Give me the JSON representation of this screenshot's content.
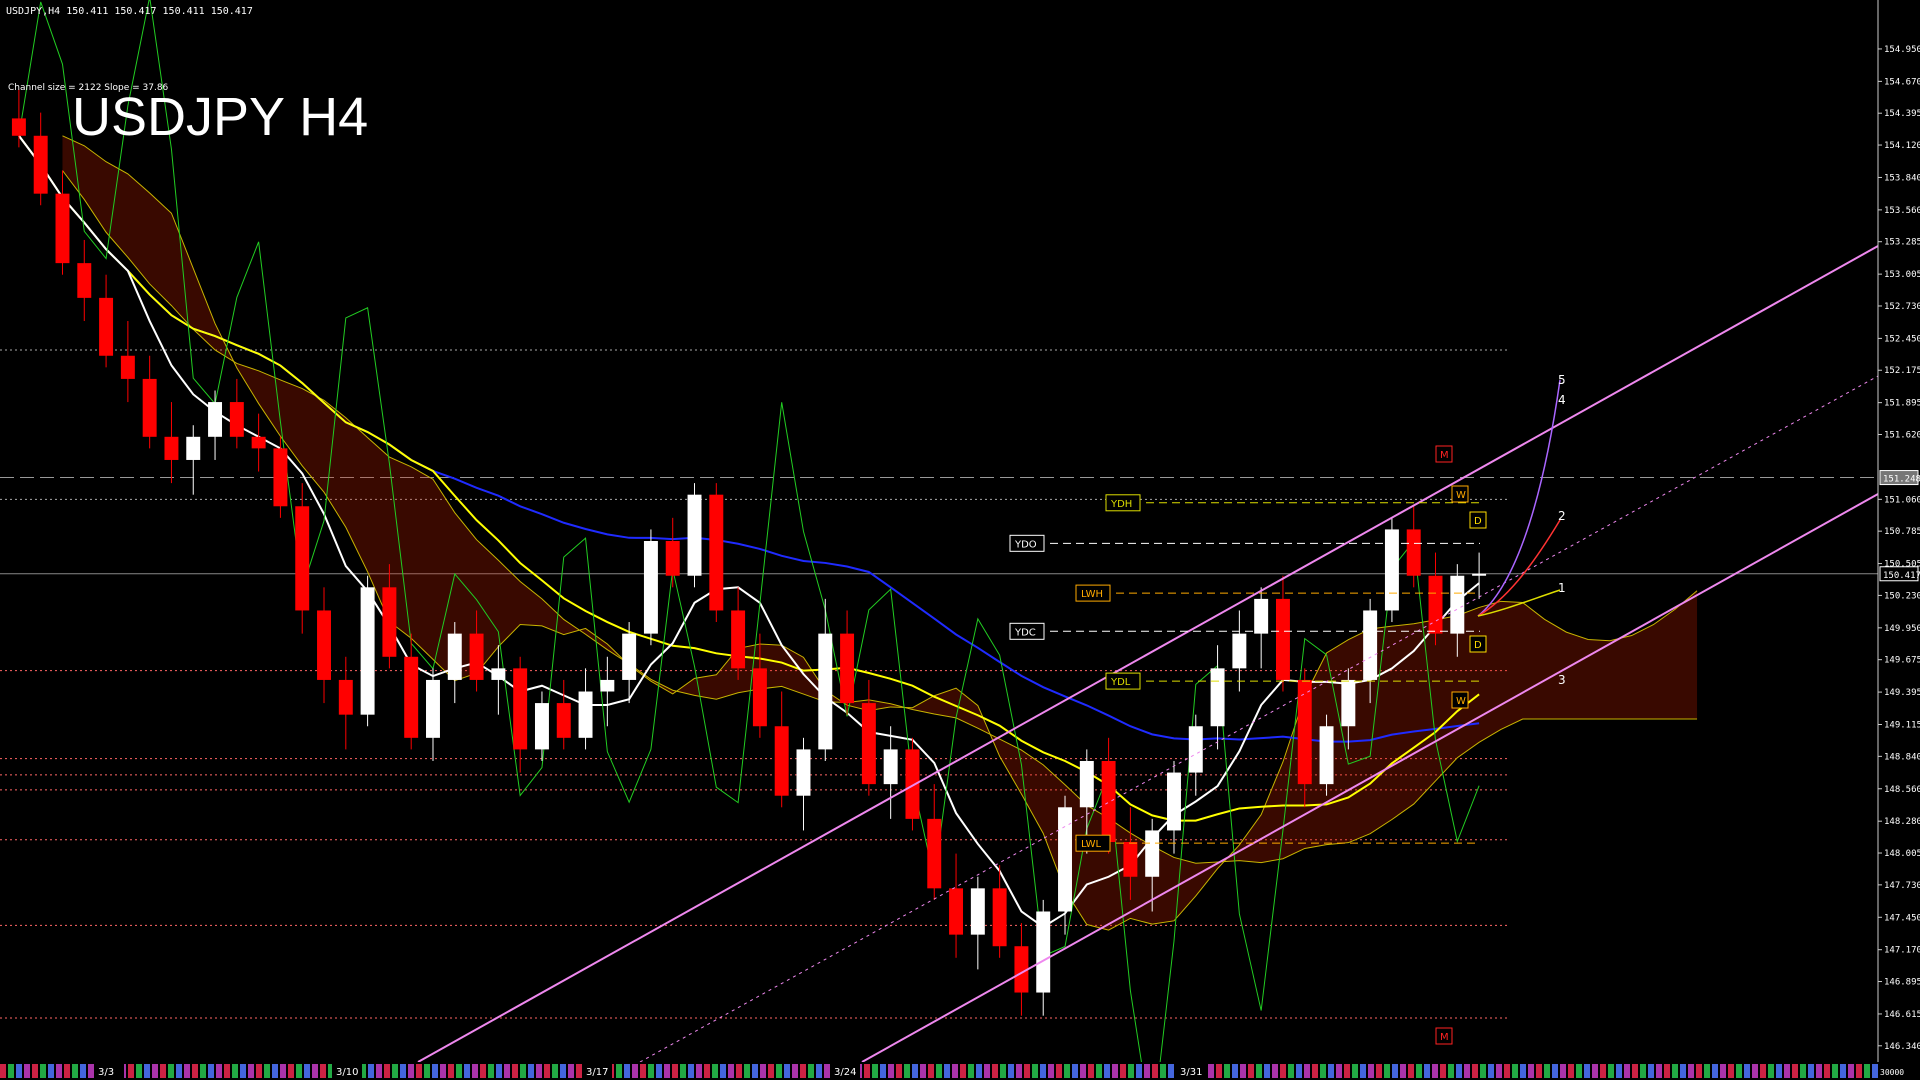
{
  "header": {
    "symbol_line": "USDJPY,H4  150.411 150.417 150.411 150.417"
  },
  "channel_info": "Channel size = 2122 Slope = 37.86",
  "big_title": "USDJPY H4",
  "colors": {
    "background": "#000000",
    "bull": "#ffffff",
    "bear": "#ff0000",
    "ma_blue": "#1f2bff",
    "ma_yellow": "#ffff00",
    "ma_white": "#ffffff",
    "green": "#22cc22",
    "channel": "#ee88ee",
    "cloud": "#cc2200",
    "cloud_line": "#c8b400"
  },
  "chart_data": {
    "type": "candlestick",
    "symbol": "USDJPY",
    "timeframe": "H4",
    "ylim": [
      146.2,
      155.2
    ],
    "y_ticks": [
      "154.950",
      "154.670",
      "154.395",
      "154.120",
      "153.840",
      "153.560",
      "153.285",
      "153.005",
      "152.730",
      "152.450",
      "152.175",
      "151.895",
      "151.620",
      "151.060",
      "150.785",
      "150.505",
      "150.230",
      "149.950",
      "149.675",
      "149.395",
      "149.115",
      "148.840",
      "148.560",
      "148.280",
      "148.005",
      "147.730",
      "147.450",
      "147.170",
      "146.895",
      "146.615",
      "146.340"
    ],
    "x_ticks": [
      "3/3",
      "3/10",
      "3/17",
      "3/24",
      "3/31"
    ],
    "current_price": "150.417",
    "highlight_price": "151.248",
    "level_labels": [
      {
        "text": "YDH",
        "price": 151.03,
        "color": "#dddd00"
      },
      {
        "text": "YDO",
        "price": 150.68,
        "color": "#ffffff"
      },
      {
        "text": "LWH",
        "price": 150.25,
        "color": "#ffaa00"
      },
      {
        "text": "YDC",
        "price": 149.92,
        "color": "#ffffff"
      },
      {
        "text": "YDL",
        "price": 149.49,
        "color": "#dddd00"
      },
      {
        "text": "LWL",
        "price": 148.09,
        "color": "#ffaa00"
      }
    ],
    "wave_labels": [
      "5",
      "4",
      "2",
      "1",
      "3"
    ],
    "box_labels": {
      "m": "M",
      "w": "W",
      "d": "D"
    },
    "horizontal_levels": [
      152.35,
      151.06,
      149.58,
      148.55,
      148.12,
      147.38,
      146.58,
      148.82,
      148.68
    ],
    "ohlc": [
      [
        154.35,
        154.6,
        154.1,
        154.2
      ],
      [
        154.2,
        154.4,
        153.6,
        153.7
      ],
      [
        153.7,
        153.9,
        153.0,
        153.1
      ],
      [
        153.1,
        153.3,
        152.6,
        152.8
      ],
      [
        152.8,
        153.0,
        152.2,
        152.3
      ],
      [
        152.3,
        152.6,
        151.9,
        152.1
      ],
      [
        152.1,
        152.3,
        151.5,
        151.6
      ],
      [
        151.6,
        151.9,
        151.2,
        151.4
      ],
      [
        151.4,
        151.7,
        151.1,
        151.6
      ],
      [
        151.6,
        152.0,
        151.4,
        151.9
      ],
      [
        151.9,
        152.1,
        151.5,
        151.6
      ],
      [
        151.6,
        151.8,
        151.3,
        151.5
      ],
      [
        151.5,
        151.6,
        150.9,
        151.0
      ],
      [
        151.0,
        151.2,
        149.9,
        150.1
      ],
      [
        150.1,
        150.3,
        149.3,
        149.5
      ],
      [
        149.5,
        149.7,
        148.9,
        149.2
      ],
      [
        149.2,
        150.4,
        149.1,
        150.3
      ],
      [
        150.3,
        150.5,
        149.6,
        149.7
      ],
      [
        149.7,
        149.9,
        148.9,
        149.0
      ],
      [
        149.0,
        149.6,
        148.8,
        149.5
      ],
      [
        149.5,
        150.0,
        149.3,
        149.9
      ],
      [
        149.9,
        150.1,
        149.4,
        149.5
      ],
      [
        149.5,
        149.8,
        149.2,
        149.6
      ],
      [
        149.6,
        149.7,
        148.7,
        148.9
      ],
      [
        148.9,
        149.4,
        148.8,
        149.3
      ],
      [
        149.3,
        149.5,
        148.9,
        149.0
      ],
      [
        149.0,
        149.6,
        148.9,
        149.4
      ],
      [
        149.4,
        149.7,
        149.1,
        149.5
      ],
      [
        149.5,
        150.0,
        149.3,
        149.9
      ],
      [
        149.9,
        150.8,
        149.8,
        150.7
      ],
      [
        150.7,
        150.9,
        150.3,
        150.4
      ],
      [
        150.4,
        151.2,
        150.3,
        151.1
      ],
      [
        151.1,
        151.2,
        150.0,
        150.1
      ],
      [
        150.1,
        150.3,
        149.5,
        149.6
      ],
      [
        149.6,
        149.9,
        149.0,
        149.1
      ],
      [
        149.1,
        149.4,
        148.4,
        148.5
      ],
      [
        148.5,
        149.0,
        148.2,
        148.9
      ],
      [
        148.9,
        150.2,
        148.8,
        149.9
      ],
      [
        149.9,
        150.1,
        149.2,
        149.3
      ],
      [
        149.3,
        149.5,
        148.5,
        148.6
      ],
      [
        148.6,
        149.1,
        148.3,
        148.9
      ],
      [
        148.9,
        149.0,
        148.2,
        148.3
      ],
      [
        148.3,
        148.6,
        147.6,
        147.7
      ],
      [
        147.7,
        148.0,
        147.1,
        147.3
      ],
      [
        147.3,
        147.8,
        147.0,
        147.7
      ],
      [
        147.7,
        147.9,
        147.1,
        147.2
      ],
      [
        147.2,
        147.4,
        146.6,
        146.8
      ],
      [
        146.8,
        147.6,
        146.6,
        147.5
      ],
      [
        147.5,
        148.5,
        147.3,
        148.4
      ],
      [
        148.4,
        148.9,
        148.0,
        148.8
      ],
      [
        148.8,
        149.0,
        148.0,
        148.1
      ],
      [
        148.1,
        148.4,
        147.6,
        147.8
      ],
      [
        147.8,
        148.3,
        147.5,
        148.2
      ],
      [
        148.2,
        148.8,
        148.0,
        148.7
      ],
      [
        148.7,
        149.2,
        148.5,
        149.1
      ],
      [
        149.1,
        149.8,
        148.9,
        149.6
      ],
      [
        149.6,
        150.1,
        149.4,
        149.9
      ],
      [
        149.9,
        150.3,
        149.6,
        150.2
      ],
      [
        150.2,
        150.4,
        149.4,
        149.5
      ],
      [
        149.5,
        149.6,
        148.4,
        148.6
      ],
      [
        148.6,
        149.2,
        148.5,
        149.1
      ],
      [
        149.1,
        149.6,
        148.9,
        149.5
      ],
      [
        149.5,
        150.2,
        149.3,
        150.1
      ],
      [
        150.1,
        150.9,
        150.0,
        150.8
      ],
      [
        150.8,
        151.0,
        150.3,
        150.4
      ],
      [
        150.4,
        150.6,
        149.8,
        149.9
      ],
      [
        149.9,
        150.5,
        149.7,
        150.4
      ],
      [
        150.4,
        150.6,
        150.2,
        150.417
      ]
    ]
  }
}
